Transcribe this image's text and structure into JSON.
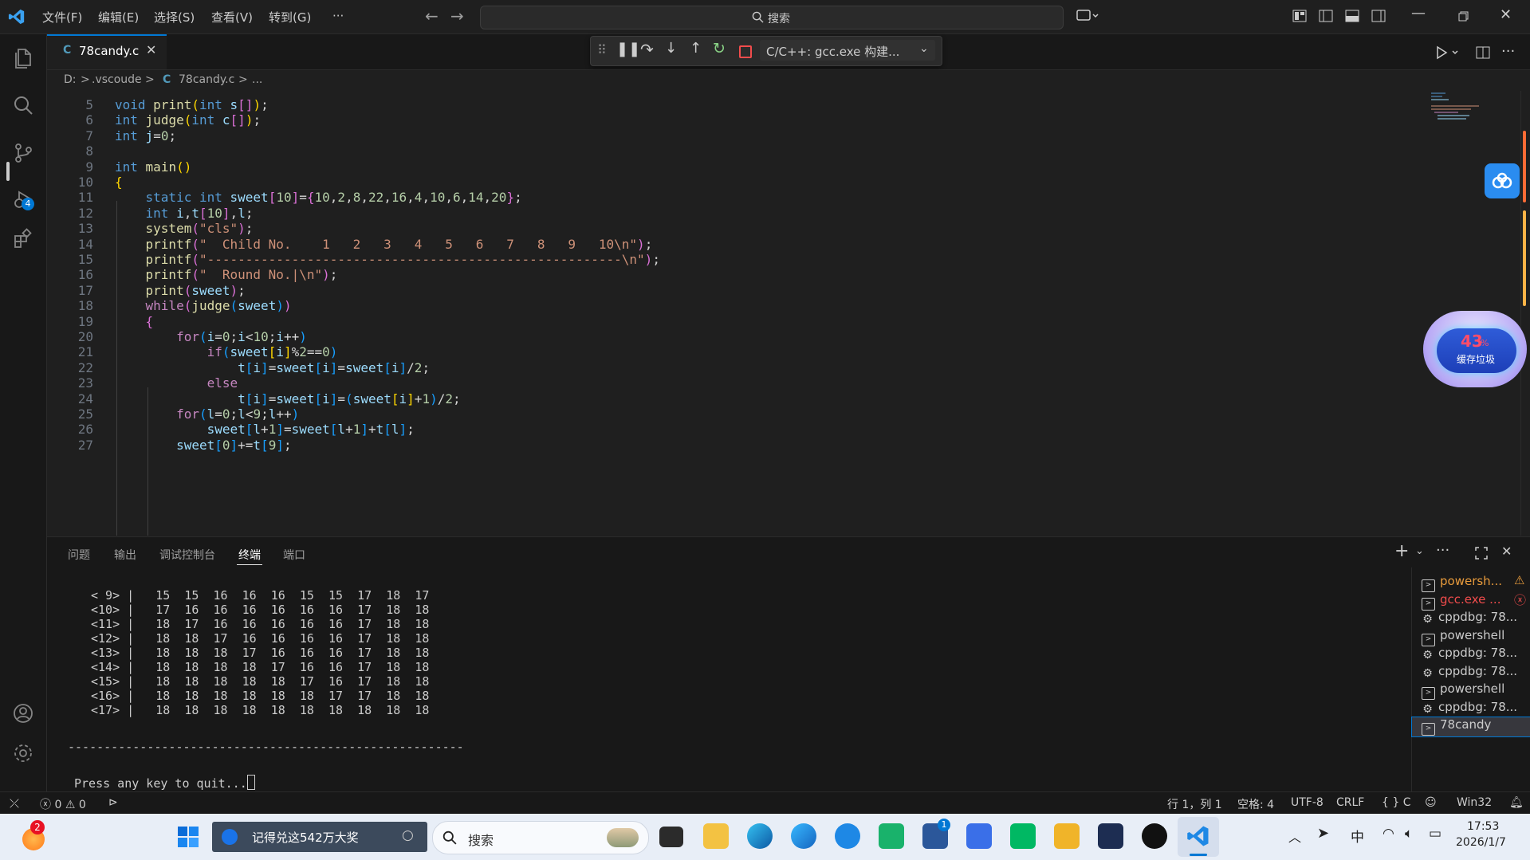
{
  "menu": [
    "文件(F)",
    "编辑(E)",
    "选择(S)",
    "查看(V)",
    "转到(G)",
    "···"
  ],
  "search": {
    "label": "搜索"
  },
  "tab": {
    "label": "78candy.c",
    "lang_icon": "C"
  },
  "debug": {
    "config": "C/C++: gcc.exe 构建..."
  },
  "breadcrumb": {
    "drive": "D:",
    "sep": ">",
    "folder": ".vscoude",
    "file": "78candy.c",
    "more": "..."
  },
  "activity": {
    "debug_badge": "4"
  },
  "code": [
    {
      "ln": "5",
      "html": "<span class='kw'>void</span> <span class='fn'>print</span><span class='br1'>(</span><span class='kw'>int</span> <span class='var'>s</span><span class='br2'>[]</span><span class='br1'>)</span>;"
    },
    {
      "ln": "6",
      "html": "<span class='kw'>int</span> <span class='fn'>judge</span><span class='br1'>(</span><span class='kw'>int</span> <span class='var'>c</span><span class='br2'>[]</span><span class='br1'>)</span>;"
    },
    {
      "ln": "7",
      "html": "<span class='kw'>int</span> <span class='var'>j</span>=<span class='num'>0</span>;"
    },
    {
      "ln": "8",
      "html": ""
    },
    {
      "ln": "9",
      "html": "<span class='kw'>int</span> <span class='fn'>main</span><span class='br1'>()</span>"
    },
    {
      "ln": "10",
      "html": "<span class='br1'>{</span>"
    },
    {
      "ln": "11",
      "html": "    <span class='kw'>static</span> <span class='kw'>int</span> <span class='var'>sweet</span><span class='br2'>[</span><span class='num'>10</span><span class='br2'>]</span>=<span class='br2'>{</span><span class='num'>10</span>,<span class='num'>2</span>,<span class='num'>8</span>,<span class='num'>22</span>,<span class='num'>16</span>,<span class='num'>4</span>,<span class='num'>10</span>,<span class='num'>6</span>,<span class='num'>14</span>,<span class='num'>20</span><span class='br2'>}</span>;"
    },
    {
      "ln": "12",
      "html": "    <span class='kw'>int</span> <span class='var'>i</span>,<span class='var'>t</span><span class='br2'>[</span><span class='num'>10</span><span class='br2'>]</span>,<span class='var'>l</span>;"
    },
    {
      "ln": "13",
      "html": "    <span class='fn'>system</span><span class='br2'>(</span><span class='str'>\"cls\"</span><span class='br2'>)</span>;"
    },
    {
      "ln": "14",
      "html": "    <span class='fn'>printf</span><span class='br2'>(</span><span class='str'>\"  Child No.    1   2   3   4   5   6   7   8   9   10\\n\"</span><span class='br2'>)</span>;"
    },
    {
      "ln": "15",
      "html": "    <span class='fn'>printf</span><span class='br2'>(</span><span class='str'>\"------------------------------------------------------\\n\"</span><span class='br2'>)</span>;"
    },
    {
      "ln": "16",
      "html": "    <span class='fn'>printf</span><span class='br2'>(</span><span class='str'>\"  Round No.|\\n\"</span><span class='br2'>)</span>;"
    },
    {
      "ln": "17",
      "html": "    <span class='fn'>print</span><span class='br2'>(</span><span class='var'>sweet</span><span class='br2'>)</span>;"
    },
    {
      "ln": "18",
      "html": "    <span class='ctl'>while</span><span class='br2'>(</span><span class='fn'>judge</span><span class='br3'>(</span><span class='var'>sweet</span><span class='br3'>)</span><span class='br2'>)</span>"
    },
    {
      "ln": "19",
      "html": "    <span class='br2'>{</span>"
    },
    {
      "ln": "20",
      "html": "        <span class='ctl'>for</span><span class='br3'>(</span><span class='var'>i</span>=<span class='num'>0</span>;<span class='var'>i</span>&lt;<span class='num'>10</span>;<span class='var'>i</span>++<span class='br3'>)</span>"
    },
    {
      "ln": "21",
      "html": "            <span class='ctl'>if</span><span class='br3'>(</span><span class='var'>sweet</span><span class='br1'>[</span><span class='var'>i</span><span class='br1'>]</span>%<span class='num'>2</span>==<span class='num'>0</span><span class='br3'>)</span>"
    },
    {
      "ln": "22",
      "html": "                <span class='var'>t</span><span class='br3'>[</span><span class='var'>i</span><span class='br3'>]</span>=<span class='var'>sweet</span><span class='br3'>[</span><span class='var'>i</span><span class='br3'>]</span>=<span class='var'>sweet</span><span class='br3'>[</span><span class='var'>i</span><span class='br3'>]</span>/<span class='num'>2</span>;"
    },
    {
      "ln": "23",
      "html": "            <span class='ctl'>else</span>"
    },
    {
      "ln": "24",
      "html": "                <span class='var'>t</span><span class='br3'>[</span><span class='var'>i</span><span class='br3'>]</span>=<span class='var'>sweet</span><span class='br3'>[</span><span class='var'>i</span><span class='br3'>]</span>=<span class='br3'>(</span><span class='var'>sweet</span><span class='br1'>[</span><span class='var'>i</span><span class='br1'>]</span>+<span class='num'>1</span><span class='br3'>)</span>/<span class='num'>2</span>;"
    },
    {
      "ln": "25",
      "html": "        <span class='ctl'>for</span><span class='br3'>(</span><span class='var'>l</span>=<span class='num'>0</span>;<span class='var'>l</span>&lt;<span class='num'>9</span>;<span class='var'>l</span>++<span class='br3'>)</span>"
    },
    {
      "ln": "26",
      "html": "            <span class='var'>sweet</span><span class='br3'>[</span><span class='var'>l</span>+<span class='num'>1</span><span class='br3'>]</span>=<span class='var'>sweet</span><span class='br3'>[</span><span class='var'>l</span>+<span class='num'>1</span><span class='br3'>]</span>+<span class='var'>t</span><span class='br3'>[</span><span class='var'>l</span><span class='br3'>]</span>;"
    },
    {
      "ln": "27",
      "html": "        <span class='var'>sweet</span><span class='br3'>[</span><span class='num'>0</span><span class='br3'>]</span>+=<span class='var'>t</span><span class='br3'>[</span><span class='num'>9</span><span class='br3'>]</span>;"
    }
  ],
  "panel_tabs": [
    "问题",
    "输出",
    "调试控制台",
    "终端",
    "端口"
  ],
  "terminal_lines": [
    "< 9> |   15  15  16  16  16  15  15  17  18  17",
    "<10> |   17  16  16  16  16  16  16  17  18  18",
    "<11> |   18  17  16  16  16  16  16  17  18  18",
    "<12> |   18  18  17  16  16  16  16  17  18  18",
    "<13> |   18  18  18  17  16  16  16  17  18  18",
    "<14> |   18  18  18  18  17  16  16  17  18  18",
    "<15> |   18  18  18  18  18  17  16  17  18  18",
    "<16> |   18  18  18  18  18  18  17  17  18  18",
    "<17> |   18  18  18  18  18  18  18  18  18  18"
  ],
  "terminal_rule": "-------------------------------------------------------",
  "terminal_prompt": "Press any key to quit...",
  "terminals": [
    {
      "label": "powersh...",
      "icon": "terminal",
      "color": "#e89b3c",
      "status": "warning"
    },
    {
      "label": "gcc.exe ...",
      "icon": "terminal",
      "color": "#f14c4c",
      "status": "error"
    },
    {
      "label": "cppdbg: 78...",
      "icon": "debug",
      "color": "#cccccc",
      "status": ""
    },
    {
      "label": "powershell",
      "icon": "terminal",
      "color": "#cccccc",
      "status": ""
    },
    {
      "label": "cppdbg: 78...",
      "icon": "debug",
      "color": "#cccccc",
      "status": ""
    },
    {
      "label": "cppdbg: 78...",
      "icon": "debug",
      "color": "#cccccc",
      "status": ""
    },
    {
      "label": "powershell",
      "icon": "terminal",
      "color": "#cccccc",
      "status": ""
    },
    {
      "label": "cppdbg: 78...",
      "icon": "debug",
      "color": "#cccccc",
      "status": ""
    },
    {
      "label": "78candy",
      "icon": "terminal",
      "color": "#cccccc",
      "status": "active"
    }
  ],
  "status": {
    "errors": "0",
    "warnings": "0",
    "position": "行 1，列 1",
    "spaces": "空格: 4",
    "encoding": "UTF-8",
    "eol": "CRLF",
    "language": "{ } C",
    "platform": "Win32"
  },
  "widget": {
    "percent": "43",
    "unit": "%",
    "label": "缓存垃圾"
  },
  "taskbar": {
    "notif_badge": "2",
    "news": "记得兑这542万大奖",
    "search": "搜索",
    "store_badge": "1",
    "time": "17:53",
    "date": "2026/1/7",
    "ime": "中"
  },
  "colors": {
    "accent": "#0078d4",
    "bg": "#1f1f1f",
    "panel": "#181818"
  }
}
